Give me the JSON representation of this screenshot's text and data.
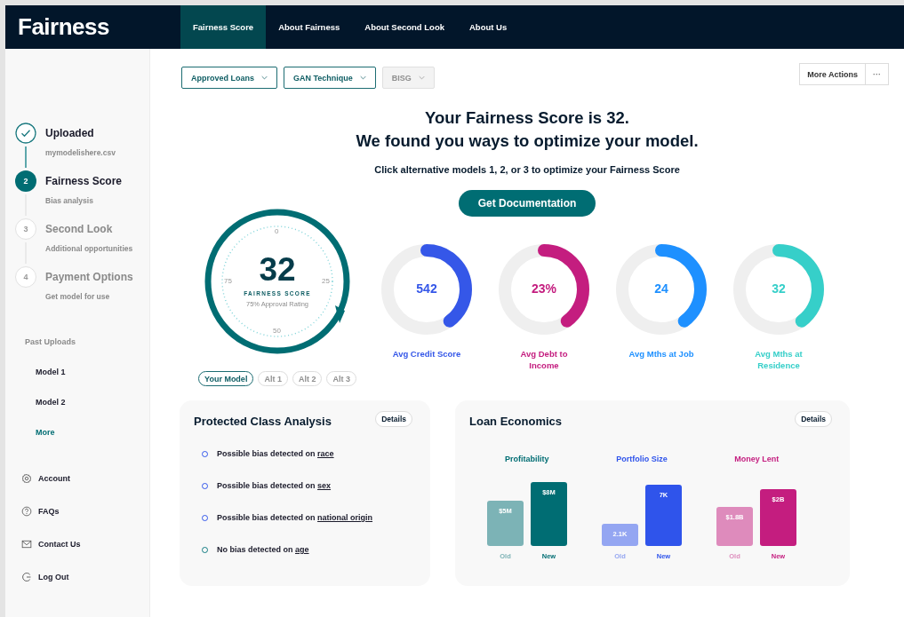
{
  "brand": "Fairness",
  "nav": [
    {
      "label": "Fairness Score",
      "selected": true
    },
    {
      "label": "About Fairness",
      "selected": false
    },
    {
      "label": "About Second Look",
      "selected": false
    },
    {
      "label": "About Us",
      "selected": false
    }
  ],
  "steps": [
    {
      "title": "Uploaded",
      "subtitle": "mymodelishere.csv",
      "done": true,
      "current": false
    },
    {
      "number": "2",
      "title": "Fairness Score",
      "subtitle": "Bias analysis",
      "done": false,
      "current": true
    },
    {
      "number": "3",
      "title": "Second Look",
      "subtitle": "Additional opportunities",
      "done": false,
      "current": false
    },
    {
      "number": "4",
      "title": "Payment Options",
      "subtitle": "Get model for use",
      "done": false,
      "current": false
    }
  ],
  "past_uploads": {
    "heading": "Past Uploads",
    "items": [
      {
        "label": "Model 1",
        "kind": "model"
      },
      {
        "label": "Model 2",
        "kind": "model"
      },
      {
        "label": "More",
        "kind": "more"
      }
    ]
  },
  "account_links": [
    {
      "label": "Account"
    },
    {
      "label": "FAQs"
    },
    {
      "label": "Contact Us"
    },
    {
      "label": "Log Out"
    }
  ],
  "filters": [
    {
      "label": "Approved Loans",
      "disabled": false
    },
    {
      "label": "GAN Technique",
      "disabled": false
    },
    {
      "label": "BISG",
      "disabled": true
    }
  ],
  "more_actions": {
    "label": "More Actions",
    "menu": "···"
  },
  "headline": [
    "Your Fairness Score is 32.",
    "We found you ways to optimize your model."
  ],
  "instruction": "Click alternative models 1, 2, or 3 to optimize your Fairness Score",
  "cta": "Get Documentation",
  "gauge": {
    "score": "32",
    "label": "FAIRNESS SCORE",
    "caption": "75% Approval Rating",
    "scale": [
      "0",
      "25",
      "50",
      "75"
    ]
  },
  "model_tabs": [
    {
      "label": "Your Model",
      "selected": true
    },
    {
      "label": "Alt 1",
      "selected": false
    },
    {
      "label": "Alt 2",
      "selected": false
    },
    {
      "label": "Alt 3",
      "selected": false
    }
  ],
  "metrics": [
    {
      "value": "542",
      "label": "Avg Credit Score",
      "color": "#3557e8",
      "level": 0.4
    },
    {
      "value": "23%",
      "label": "Avg Debt to Income",
      "color": "#c41d7f",
      "level": 0.4
    },
    {
      "value": "24",
      "label": "Avg Mths at Job",
      "color": "#1e90ff",
      "level": 0.4
    },
    {
      "value": "32",
      "label": "Avg Mths at Residence",
      "color": "#36cfc9",
      "level": 0.4
    }
  ],
  "protected": {
    "title": "Protected Class Analysis",
    "details": "Details",
    "items": [
      {
        "text": "Possible bias detected on",
        "link": "race",
        "flagged": true
      },
      {
        "text": "Possible bias detected on",
        "link": "sex",
        "flagged": true
      },
      {
        "text": "Possible bias detected on",
        "link": "national origin",
        "flagged": true
      },
      {
        "text": "No bias detected on",
        "link": "age",
        "flagged": false
      }
    ]
  },
  "loan": {
    "title": "Loan Economics",
    "details": "Details",
    "charts": [
      {
        "title": "Profitability",
        "color": "#006d73",
        "bars": [
          {
            "label": "Old",
            "value": "$5M"
          },
          {
            "label": "New",
            "value": "$8M"
          }
        ]
      },
      {
        "title": "Portfolio Size",
        "color": "#2f54eb",
        "bars": [
          {
            "label": "Old",
            "value": "2.1K"
          },
          {
            "label": "New",
            "value": "7K"
          }
        ]
      },
      {
        "title": "Money Lent",
        "color": "#c41d7f",
        "bars": [
          {
            "label": "Old",
            "value": "$1.8B"
          },
          {
            "label": "New",
            "value": "$2B"
          }
        ]
      }
    ]
  }
}
